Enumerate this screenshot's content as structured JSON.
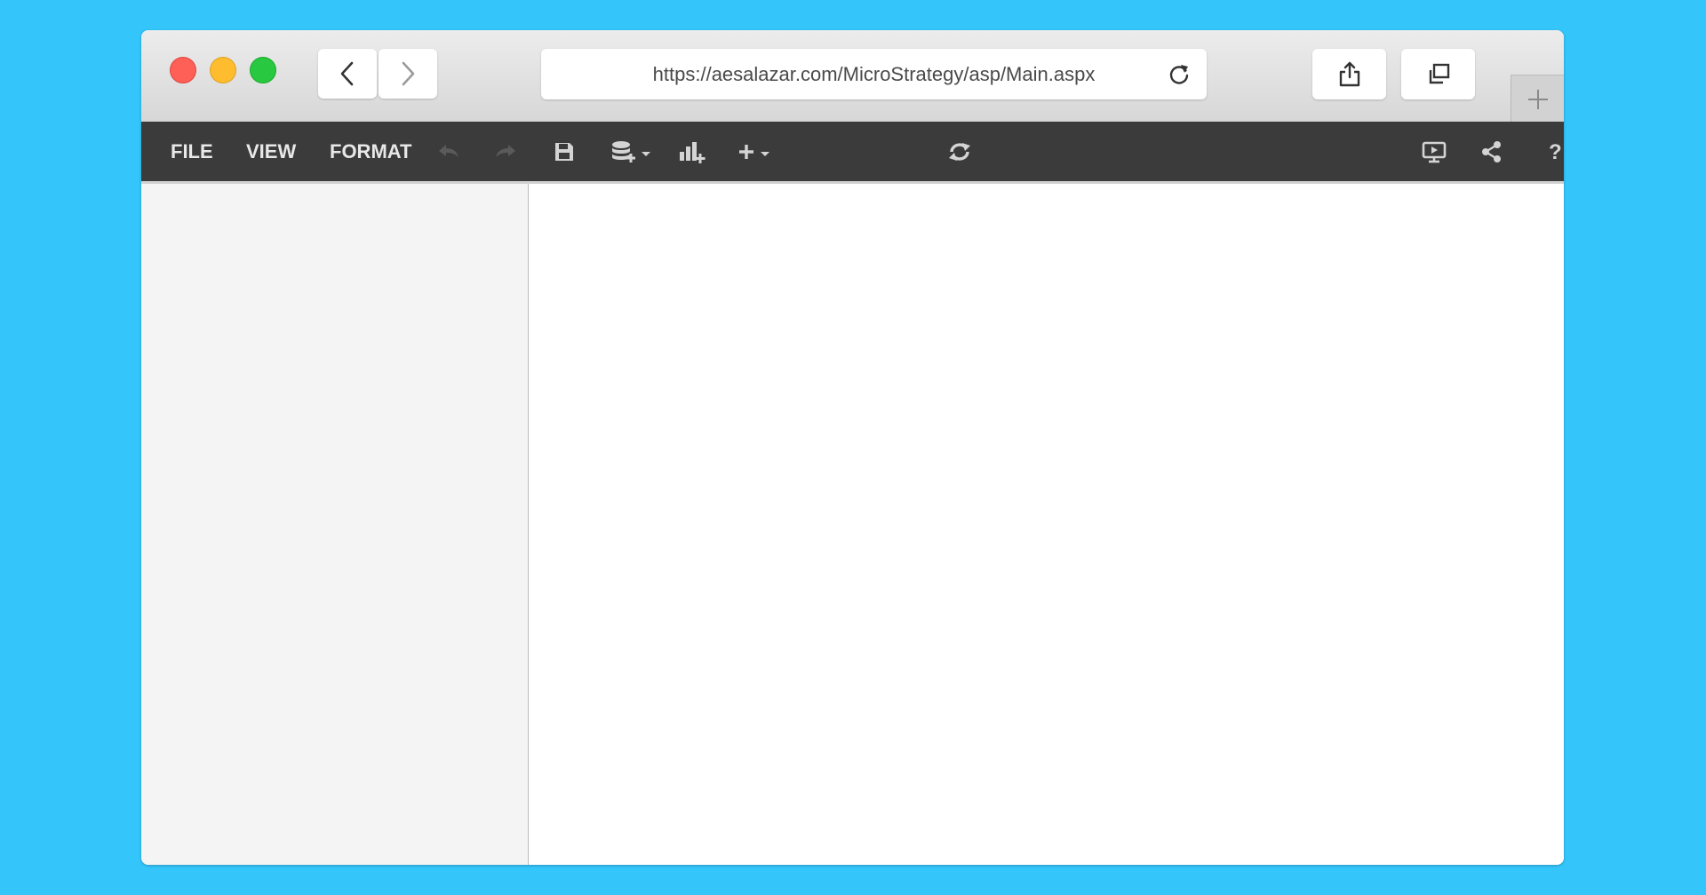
{
  "browser": {
    "url": "https://aesalazar.com/MicroStrategy/asp/Main.aspx",
    "traffic_lights": [
      "close",
      "minimize",
      "zoom"
    ],
    "icons": {
      "back": "chevron-left-icon",
      "forward": "chevron-right-icon",
      "reload": "reload-icon",
      "share": "share-icon",
      "tabs": "tabs-overview-icon",
      "new_tab": "plus-icon"
    }
  },
  "app": {
    "menus": [
      "FILE",
      "VIEW",
      "FORMAT"
    ],
    "toolbar_icons": [
      "undo-icon",
      "redo-icon",
      "save-icon",
      "add-data-icon",
      "add-visualization-icon",
      "insert-icon",
      "refresh-icon",
      "presentation-mode-icon",
      "share-icon",
      "help-icon",
      "collapse-icon",
      "close-icon"
    ]
  },
  "colors": {
    "background": "#34c6fb",
    "app_toolbar": "#3b3b3b",
    "left_panel": "#f4f4f4"
  }
}
